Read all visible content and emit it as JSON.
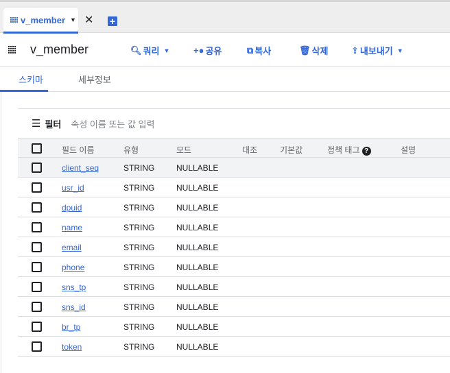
{
  "tab": {
    "label": "v_member"
  },
  "toolbar": {
    "title": "v_member",
    "query": "쿼리",
    "share": "공유",
    "copy": "복사",
    "delete": "삭제",
    "export": "내보내기"
  },
  "subtabs": {
    "schema": "스키마",
    "details": "세부정보"
  },
  "filter": {
    "label": "필터",
    "placeholder": "속성 이름 또는 값 입력"
  },
  "columns": {
    "name": "필드 이름",
    "type": "유형",
    "mode": "모드",
    "collation": "대조",
    "default": "기본값",
    "policy": "정책 태그",
    "desc": "설명"
  },
  "rows": [
    {
      "name": "client_seq",
      "type": "STRING",
      "mode": "NULLABLE"
    },
    {
      "name": "usr_id",
      "type": "STRING",
      "mode": "NULLABLE"
    },
    {
      "name": "dpuid",
      "type": "STRING",
      "mode": "NULLABLE"
    },
    {
      "name": "name",
      "type": "STRING",
      "mode": "NULLABLE"
    },
    {
      "name": "email",
      "type": "STRING",
      "mode": "NULLABLE"
    },
    {
      "name": "phone",
      "type": "STRING",
      "mode": "NULLABLE"
    },
    {
      "name": "sns_tp",
      "type": "STRING",
      "mode": "NULLABLE"
    },
    {
      "name": "sns_id",
      "type": "STRING",
      "mode": "NULLABLE"
    },
    {
      "name": "br_tp",
      "type": "STRING",
      "mode": "NULLABLE"
    },
    {
      "name": "token",
      "type": "STRING",
      "mode": "NULLABLE"
    }
  ]
}
